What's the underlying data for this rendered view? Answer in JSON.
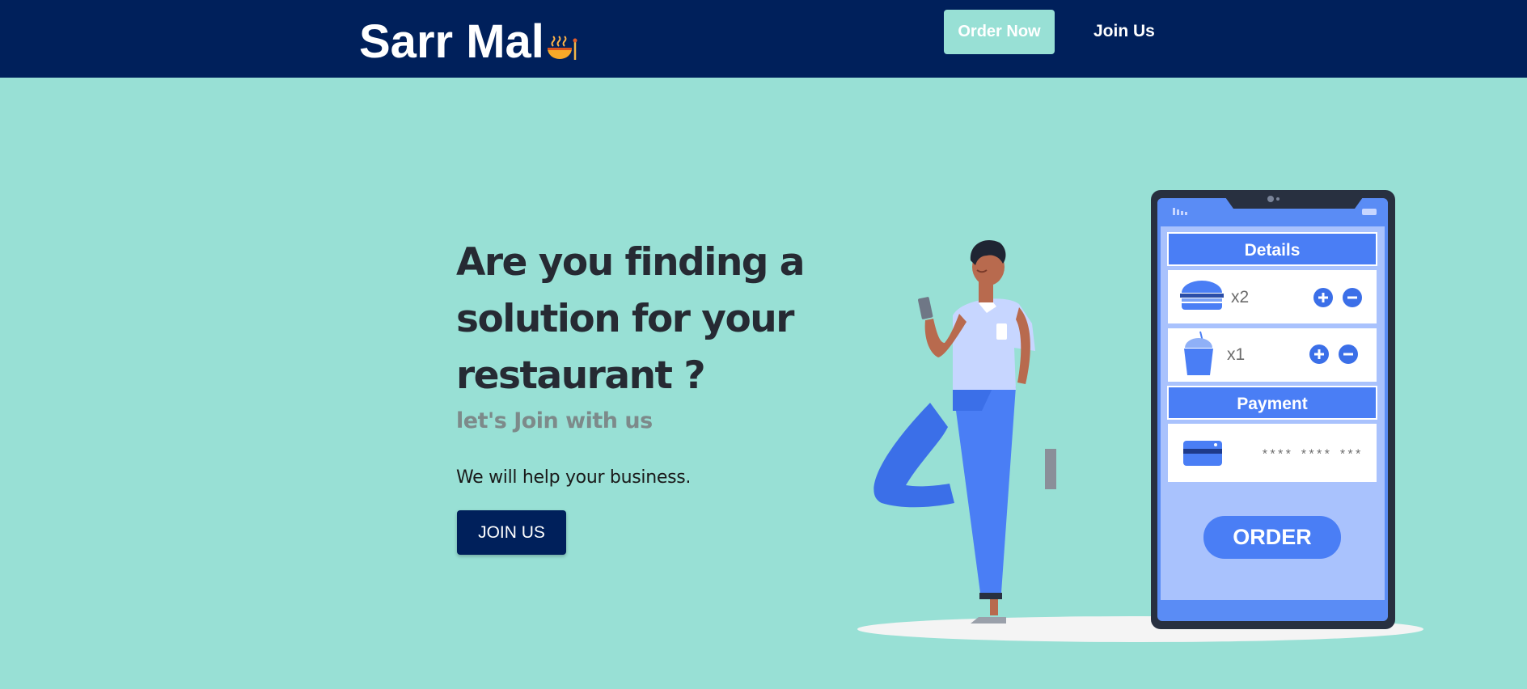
{
  "nav": {
    "brand": "Sarr Mal",
    "brand_icon": "noodle-bowl-icon",
    "order_now": "Order Now",
    "join_us": "Join Us"
  },
  "hero": {
    "title": "Are you finding a solution for your restaurant ?",
    "subtitle": "let's Join with us",
    "text": "We will help your business.",
    "cta": "JOIN US"
  },
  "illustration": {
    "details_label": "Details",
    "item1_qty": "x2",
    "item1_icon": "burger-icon",
    "item2_qty": "x1",
    "item2_icon": "drink-cup-icon",
    "payment_label": "Payment",
    "card_icon": "credit-card-icon",
    "card_number": "**** **** ***",
    "order_label": "ORDER"
  },
  "colors": {
    "navbar": "#00205b",
    "background": "#98e0d5",
    "accent_blue": "#4a7ef5",
    "primary_button": "#00205b"
  }
}
